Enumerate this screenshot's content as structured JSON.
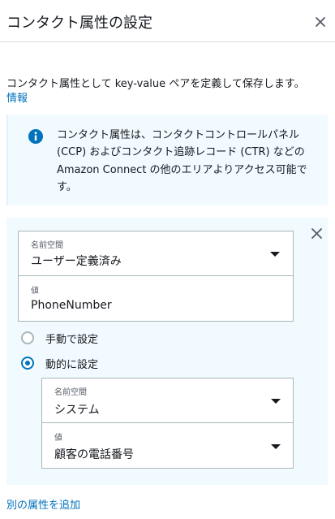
{
  "header": {
    "title": "コンタクト属性の設定",
    "close_icon": "close-icon"
  },
  "description": {
    "text": "コンタクト属性として key-value ペアを定義して保存します。",
    "info_link": "情報"
  },
  "alert": {
    "icon": "info-icon",
    "accent_color": "#0073bb",
    "text": "コンタクト属性は、コンタクトコントロールパネル (CCP) およびコンタクト追跡レコード (CTR) などの Amazon Connect の他のエリアよりアクセス可能です。"
  },
  "attribute": {
    "remove_icon": "close-icon",
    "namespace": {
      "label": "名前空間",
      "value": "ユーザー定義済み"
    },
    "key": {
      "label": "値",
      "value": "PhoneNumber"
    },
    "mode_options": [
      {
        "label": "手動で設定",
        "selected": false
      },
      {
        "label": "動的に設定",
        "selected": true
      }
    ],
    "dynamic_namespace": {
      "label": "名前空間",
      "value": "システム"
    },
    "dynamic_value": {
      "label": "値",
      "value": "顧客の電話番号"
    }
  },
  "add_attribute_link": "別の属性を追加",
  "colors": {
    "link": "#0073bb",
    "panel_bg": "#f1faff",
    "text": "#16191f"
  }
}
